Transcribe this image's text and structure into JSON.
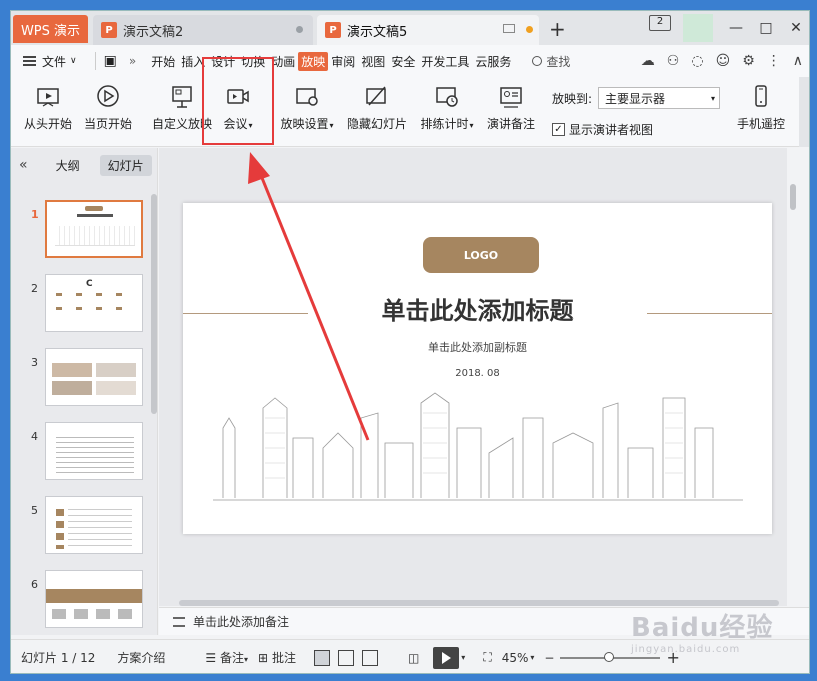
{
  "tabs": {
    "app": "WPS 演示",
    "docs": [
      {
        "label": "演示文稿2"
      },
      {
        "label": "演示文稿5"
      }
    ],
    "new_tab": "+",
    "badge": "2"
  },
  "menu": {
    "file": "文件",
    "items": [
      "开始",
      "插入",
      "设计",
      "切换",
      "动画",
      "放映",
      "审阅",
      "视图",
      "安全",
      "开发工具",
      "云服务"
    ],
    "active": "放映",
    "search": "查找"
  },
  "ribbon": {
    "buttons": [
      {
        "label": "从头开始",
        "icon": "play-from-start-icon"
      },
      {
        "label": "当页开始",
        "icon": "play-circle-icon"
      },
      {
        "label": "自定义放映",
        "icon": "custom-show-icon"
      },
      {
        "label": "会议",
        "icon": "video-meeting-icon"
      },
      {
        "label": "放映设置",
        "icon": "show-settings-icon"
      },
      {
        "label": "隐藏幻灯片",
        "icon": "hide-slide-icon"
      },
      {
        "label": "排练计时",
        "icon": "rehearse-timing-icon"
      },
      {
        "label": "演讲备注",
        "icon": "speaker-notes-icon"
      },
      {
        "label": "手机遥控",
        "icon": "phone-remote-icon"
      }
    ],
    "play_to_label": "放映到:",
    "play_to_value": "主要显示器",
    "presenter_view": "显示演讲者视图"
  },
  "left_panel": {
    "tab_outline": "大纲",
    "tab_slides": "幻灯片",
    "thumbs": [
      "1",
      "2",
      "3",
      "4",
      "5",
      "6"
    ]
  },
  "slide": {
    "logo": "LOGO",
    "title": "单击此处添加标题",
    "subtitle": "单击此处添加副标题",
    "date": "2018. 08"
  },
  "notes": {
    "placeholder": "单击此处添加备注"
  },
  "status": {
    "slide_count": "幻灯片 1 / 12",
    "theme": "方案介绍",
    "notes_btn": "备注",
    "comment_btn": "批注",
    "zoom": "45%"
  },
  "watermark": {
    "text": "Baidu经验",
    "url": "jingyan.baidu.com"
  },
  "colors": {
    "accent": "#e8683e",
    "logo_box": "#a68660",
    "highlight": "#e53b3b"
  }
}
